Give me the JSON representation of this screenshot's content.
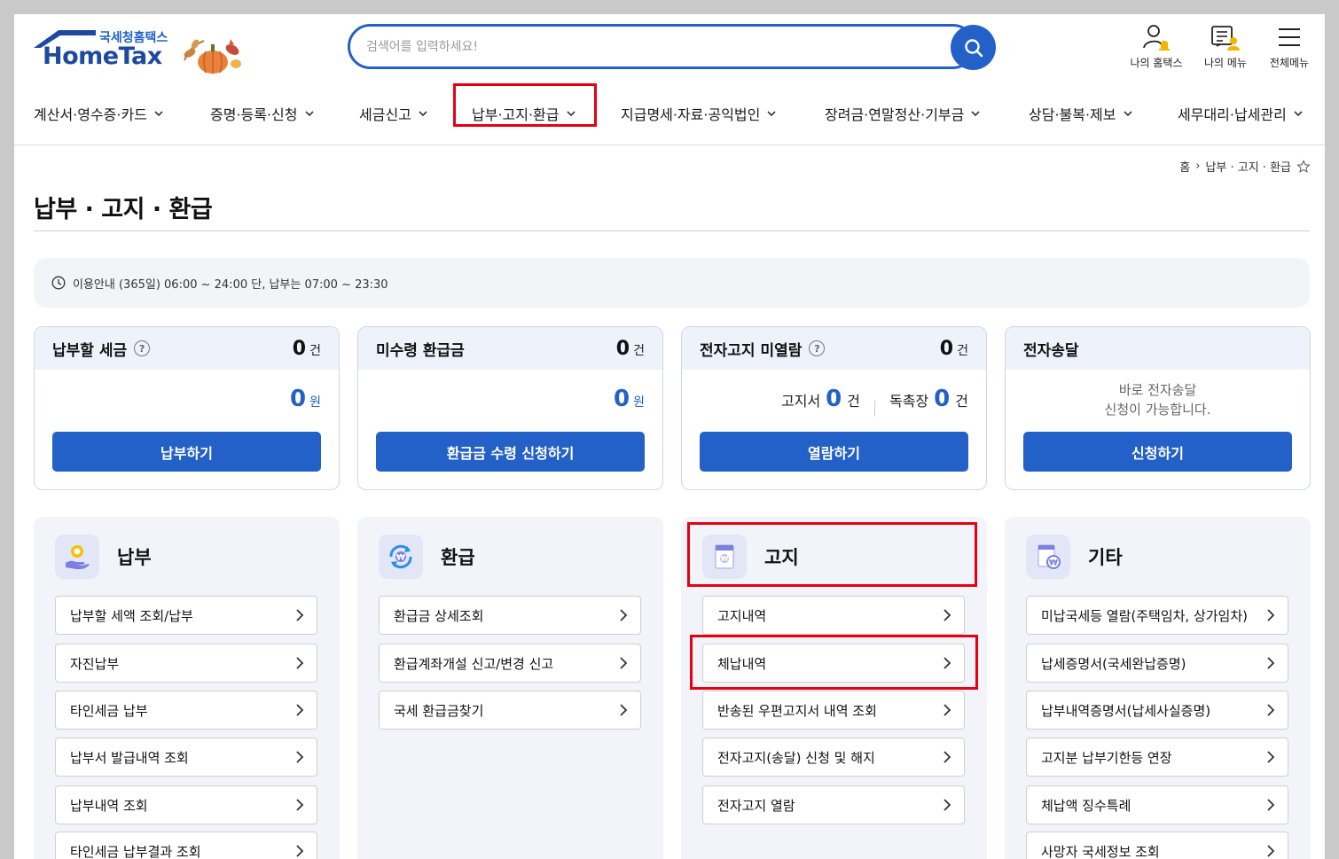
{
  "logo": {
    "sub": "국세청홈택스",
    "main": "HomeTax"
  },
  "search": {
    "placeholder": "검색어를 입력하세요!"
  },
  "utility": [
    {
      "label": "나의 홈택스",
      "icon": "user-bell-icon"
    },
    {
      "label": "나의 메뉴",
      "icon": "my-menu-icon"
    },
    {
      "label": "전체메뉴",
      "icon": "hamburger-icon"
    }
  ],
  "gnb": [
    {
      "label": "계산서·영수증·카드"
    },
    {
      "label": "증명·등록·신청"
    },
    {
      "label": "세금신고"
    },
    {
      "label": "납부·고지·환급"
    },
    {
      "label": "지급명세·자료·공익법인"
    },
    {
      "label": "장려금·연말정산·기부금"
    },
    {
      "label": "상담·불복·제보"
    },
    {
      "label": "세무대리·납세관리"
    }
  ],
  "breadcrumb": {
    "home": "홈",
    "sep": "›",
    "current": "납부 · 고지 · 환급"
  },
  "page_title": "납부 · 고지 · 환급",
  "notice": "이용안내 (365일) 06:00 ~ 24:00 단, 납부는 07:00 ~ 23:30",
  "cards": [
    {
      "title": "납부할 세금",
      "help": "?",
      "count": "0",
      "count_unit": "건",
      "amount": "0",
      "amount_unit": "원",
      "button": "납부하기"
    },
    {
      "title": "미수령 환급금",
      "count": "0",
      "count_unit": "건",
      "amount": "0",
      "amount_unit": "원",
      "button": "환급금 수령 신청하기"
    },
    {
      "title": "전자고지 미열람",
      "help": "?",
      "count": "0",
      "count_unit": "건",
      "notice_label": "고지서",
      "notice_count": "0",
      "notice_unit": "건",
      "reminder_label": "독촉장",
      "reminder_count": "0",
      "reminder_unit": "건",
      "button": "열람하기"
    },
    {
      "title": "전자송달",
      "message_line1": "바로 전자송달",
      "message_line2": "신청이 가능합니다.",
      "button": "신청하기"
    }
  ],
  "panels": [
    {
      "title": "납부",
      "links": [
        "납부할 세액 조회/납부",
        "자진납부",
        "타인세금 납부",
        "납부서 발급내역 조회",
        "납부내역 조회",
        "타인세금 납부결과 조회"
      ]
    },
    {
      "title": "환급",
      "links": [
        "환급금 상세조회",
        "환급계좌개설 신고/변경 신고",
        "국세 환급금찾기"
      ]
    },
    {
      "title": "고지",
      "links": [
        "고지내역",
        "체납내역",
        "반송된 우편고지서 내역 조회",
        "전자고지(송달) 신청 및 해지",
        "전자고지 열람"
      ]
    },
    {
      "title": "기타",
      "links": [
        "미납국세등 열람(주택임차, 상가임차)",
        "납세증명서(국세완납증명)",
        "납부내역증명서(납세사실증명)",
        "고지분 납부기한등 연장",
        "체납액 징수특례",
        "사망자 국세정보 조회"
      ]
    }
  ],
  "colors": {
    "primary": "#2361c8",
    "highlight": "#e60012"
  }
}
